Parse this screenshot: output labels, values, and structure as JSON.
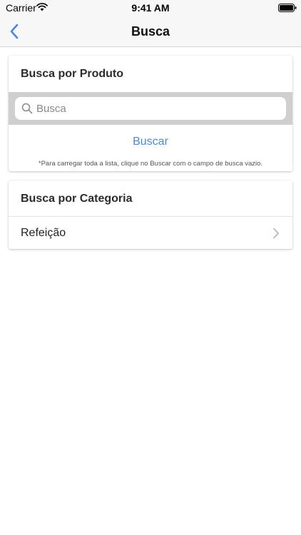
{
  "status_bar": {
    "carrier": "Carrier",
    "time": "9:41 AM"
  },
  "nav": {
    "title": "Busca",
    "back_icon": "chevron-left-icon"
  },
  "product_search": {
    "header": "Busca por Produto",
    "placeholder": "Busca",
    "value": "",
    "button_label": "Buscar",
    "hint": "*Para carregar toda a lista, clique no Buscar com o campo de busca vazio."
  },
  "category_search": {
    "header": "Busca por Categoria",
    "items": [
      {
        "label": "Refeição"
      }
    ]
  },
  "colors": {
    "accent": "#4a8ad8",
    "nav_background": "#f7f7f7",
    "search_band": "#cfcfcf"
  }
}
